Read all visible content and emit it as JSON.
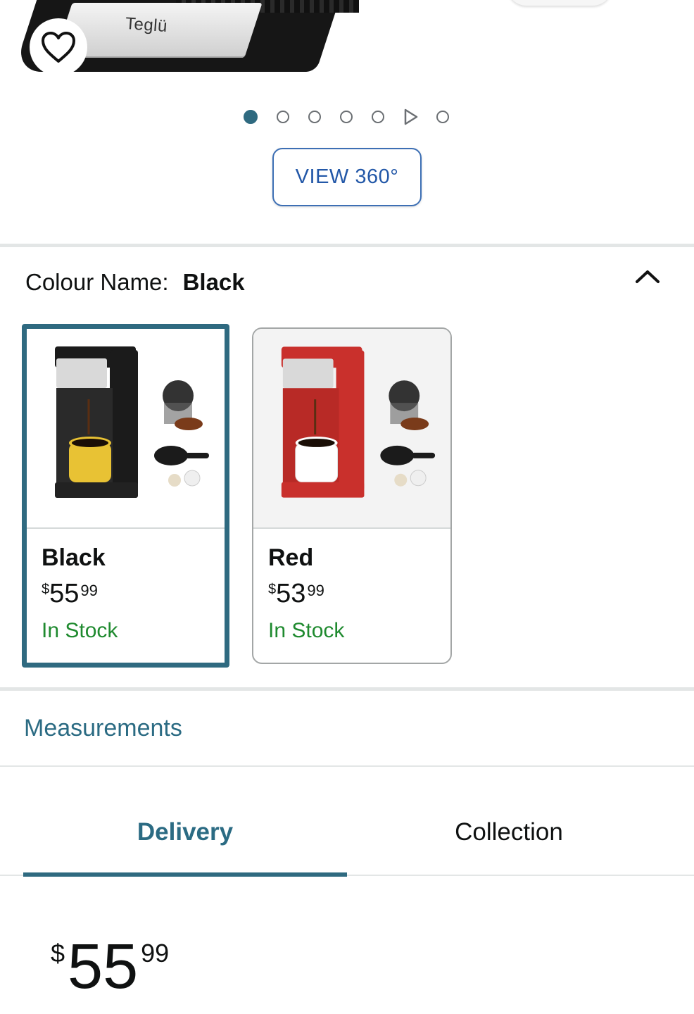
{
  "hero": {
    "brand_text": "Teglü",
    "carousel_total": 7,
    "carousel_active": 0,
    "video_slide": 6
  },
  "view360": {
    "label": "VIEW 360°"
  },
  "variant": {
    "label": "Colour Name:",
    "selected": "Black"
  },
  "options": [
    {
      "name": "Black",
      "currency": "$",
      "whole": "55",
      "cents": "99",
      "stock": "In Stock",
      "body_color": "#1b1b1b",
      "mug_color": "#e8c234"
    },
    {
      "name": "Red",
      "currency": "$",
      "whole": "53",
      "cents": "99",
      "stock": "In Stock",
      "body_color": "#c9302c",
      "mug_color": "#ffffff"
    }
  ],
  "measurements": {
    "label": "Measurements"
  },
  "tabs": [
    {
      "label": "Delivery",
      "active": true
    },
    {
      "label": "Collection",
      "active": false
    }
  ],
  "price": {
    "currency": "$",
    "whole": "55",
    "cents": "99"
  },
  "colors": {
    "accent": "#2f6a80",
    "link": "#2b6b83",
    "in_stock": "#1f8a2f",
    "button_border": "#3d6fb4"
  }
}
